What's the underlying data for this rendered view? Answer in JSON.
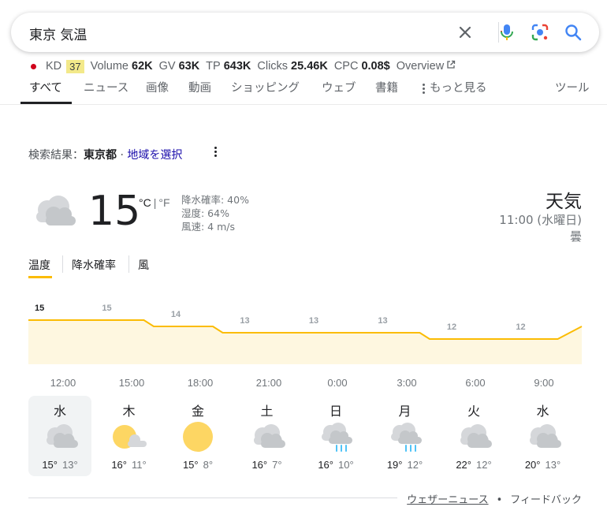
{
  "search": {
    "query": "東京 気温"
  },
  "seo": {
    "kd_label": "KD",
    "kd_value": "37",
    "volume_label": "Volume",
    "volume_value": "62K",
    "gv_label": "GV",
    "gv_value": "63K",
    "tp_label": "TP",
    "tp_value": "643K",
    "clicks_label": "Clicks",
    "clicks_value": "25.46K",
    "cpc_label": "CPC",
    "cpc_value": "0.08$",
    "overview_label": "Overview"
  },
  "tabs": [
    {
      "label": "すべて"
    },
    {
      "label": "ニュース"
    },
    {
      "label": "画像"
    },
    {
      "label": "動画"
    },
    {
      "label": "ショッピング"
    },
    {
      "label": "ウェブ"
    },
    {
      "label": "書籍"
    },
    {
      "label": "もっと見る"
    }
  ],
  "tools_label": "ツール",
  "location": {
    "prefix": "検索結果：",
    "place": "東京都",
    "separator": "·",
    "link": "地域を選択"
  },
  "current": {
    "temp": "15",
    "unit_c": "°C",
    "unit_f": "°F",
    "unit_sep": "|",
    "precip": "降水確率: 40%",
    "humidity": "湿度: 64%",
    "wind": "風速: 4 m/s",
    "title": "天気",
    "time": "11:00 (水曜日)",
    "condition": "曇"
  },
  "subtabs": [
    {
      "label": "温度"
    },
    {
      "label": "降水確率"
    },
    {
      "label": "風"
    }
  ],
  "chart_data": {
    "type": "area",
    "x": [
      "12:00",
      "15:00",
      "18:00",
      "21:00",
      "0:00",
      "3:00",
      "6:00",
      "9:00"
    ],
    "values": [
      15,
      15,
      14,
      13,
      13,
      13,
      12,
      12
    ],
    "title": "",
    "xlabel": "",
    "ylabel": ""
  },
  "time_labels": [
    "12:00",
    "15:00",
    "18:00",
    "21:00",
    "0:00",
    "3:00",
    "6:00",
    "9:00"
  ],
  "days": [
    {
      "name": "水",
      "icon": "cloudy-icon",
      "hi": "15°",
      "lo": "13°"
    },
    {
      "name": "木",
      "icon": "partly-cloudy-icon",
      "hi": "16°",
      "lo": "11°"
    },
    {
      "name": "金",
      "icon": "sunny-icon",
      "hi": "15°",
      "lo": "8°"
    },
    {
      "name": "土",
      "icon": "cloudy-icon",
      "hi": "16°",
      "lo": "7°"
    },
    {
      "name": "日",
      "icon": "rain-icon",
      "hi": "16°",
      "lo": "10°"
    },
    {
      "name": "月",
      "icon": "rain-icon",
      "hi": "19°",
      "lo": "12°"
    },
    {
      "name": "火",
      "icon": "cloudy-icon",
      "hi": "22°",
      "lo": "12°"
    },
    {
      "name": "水",
      "icon": "cloudy-icon",
      "hi": "20°",
      "lo": "13°"
    }
  ],
  "footer": {
    "news": "ウェザーニュース",
    "dot": "•",
    "feedback": "フィードバック"
  },
  "colors": {
    "chart_line": "#fbbc04",
    "chart_fill": "#fef7e0",
    "sun": "#fdd663",
    "rain": "#4fc3f7"
  }
}
